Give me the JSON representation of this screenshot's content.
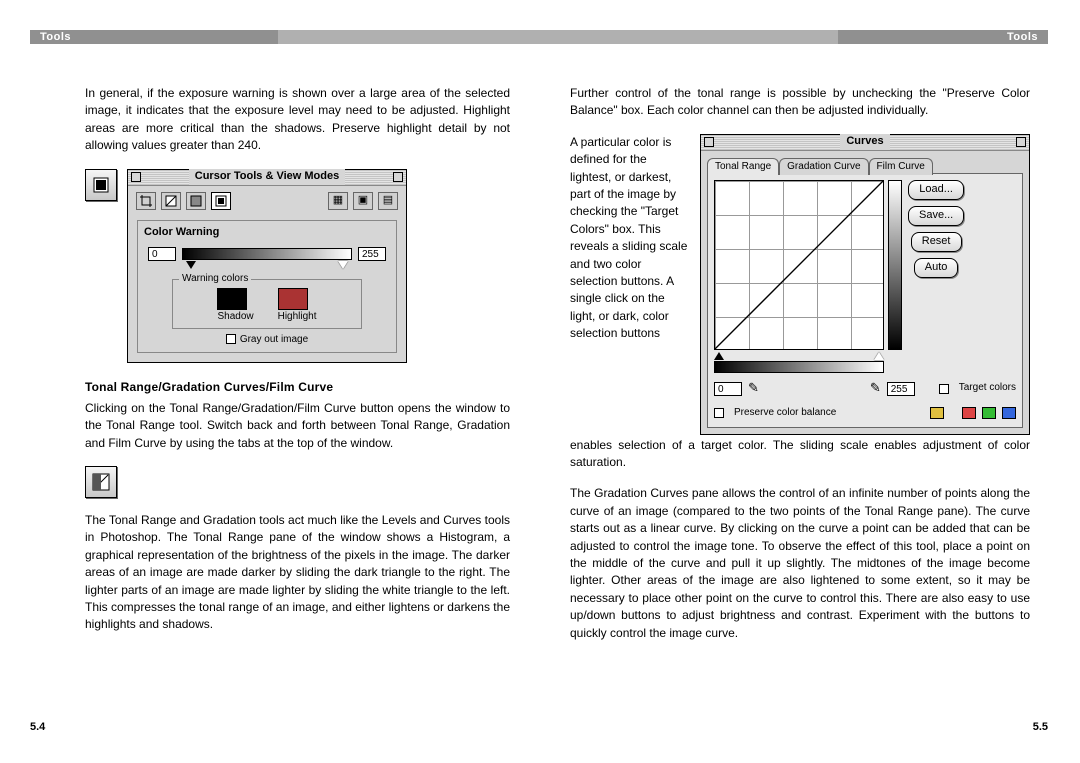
{
  "header": {
    "left": "Tools",
    "right": "Tools"
  },
  "pagenum": {
    "left": "5.4",
    "right": "5.5"
  },
  "left": {
    "p1": "In general, if the exposure warning is shown over a large area of the selected image, it indicates that the exposure level may need to be adjusted. Highlight areas are more critical than the shadows. Preserve highlight detail by not allowing values greater than 240.",
    "shot1": {
      "title": "Cursor Tools & View Modes",
      "section": "Color Warning",
      "val_min": "0",
      "val_max": "255",
      "warning_colors": "Warning colors",
      "shadow": "Shadow",
      "highlight": "Highlight",
      "grayout": "Gray out image"
    },
    "h1": "Tonal Range/Gradation Curves/Film Curve",
    "p2": "Clicking on the Tonal Range/Gradation/Film Curve button opens the window to the Tonal Range tool. Switch back and forth between Tonal Range, Gradation and Film Curve by using the tabs at the top of the window.",
    "p3": "The Tonal Range and Gradation tools act much like the Levels and Curves tools in Photoshop. The Tonal Range pane of the window shows a Histogram, a graphical representation of the brightness of the pixels in the image. The darker areas of an image are made darker by sliding the dark triangle to the right. The lighter parts of an image are made lighter by sliding the white triangle to the left. This compresses the tonal range of an image, and either lightens or darkens the highlights and shadows."
  },
  "right": {
    "p1": "Further control of the tonal range is possible by unchecking the \"Preserve Color Balance\" box. Each color channel can then be adjusted individually.",
    "wrap": "A particular color is defined for the lightest, or darkest, part of the image by checking the \"Target Colors\" box. This reveals a sliding scale and two color selection buttons. A single click on the light, or dark, color selection buttons",
    "p2tail": "enables selection of a target color. The sliding scale enables adjustment of color saturation.",
    "p3": "The Gradation Curves pane allows the control of an infinite number of points along the curve of an image (compared to the two points of the Tonal Range pane). The curve starts out as a linear curve. By clicking on the curve a point can be added that can be adjusted to control the image tone. To observe the effect of this tool, place a point on the middle of the curve and pull it up slightly. The midtones of the image become lighter. Other areas of the image are also lightened to some extent, so it may be necessary to place other point on the curve to control this. There are also easy to use up/down buttons to adjust brightness and contrast. Experiment with the buttons to quickly control the image curve.",
    "curves": {
      "title": "Curves",
      "tab1": "Tonal Range",
      "tab2": "Gradation Curve",
      "tab3": "Film Curve",
      "load": "Load...",
      "save": "Save...",
      "reset": "Reset",
      "auto": "Auto",
      "val_min": "0",
      "val_max": "255",
      "target": "Target colors",
      "preserve": "Preserve color balance"
    }
  }
}
